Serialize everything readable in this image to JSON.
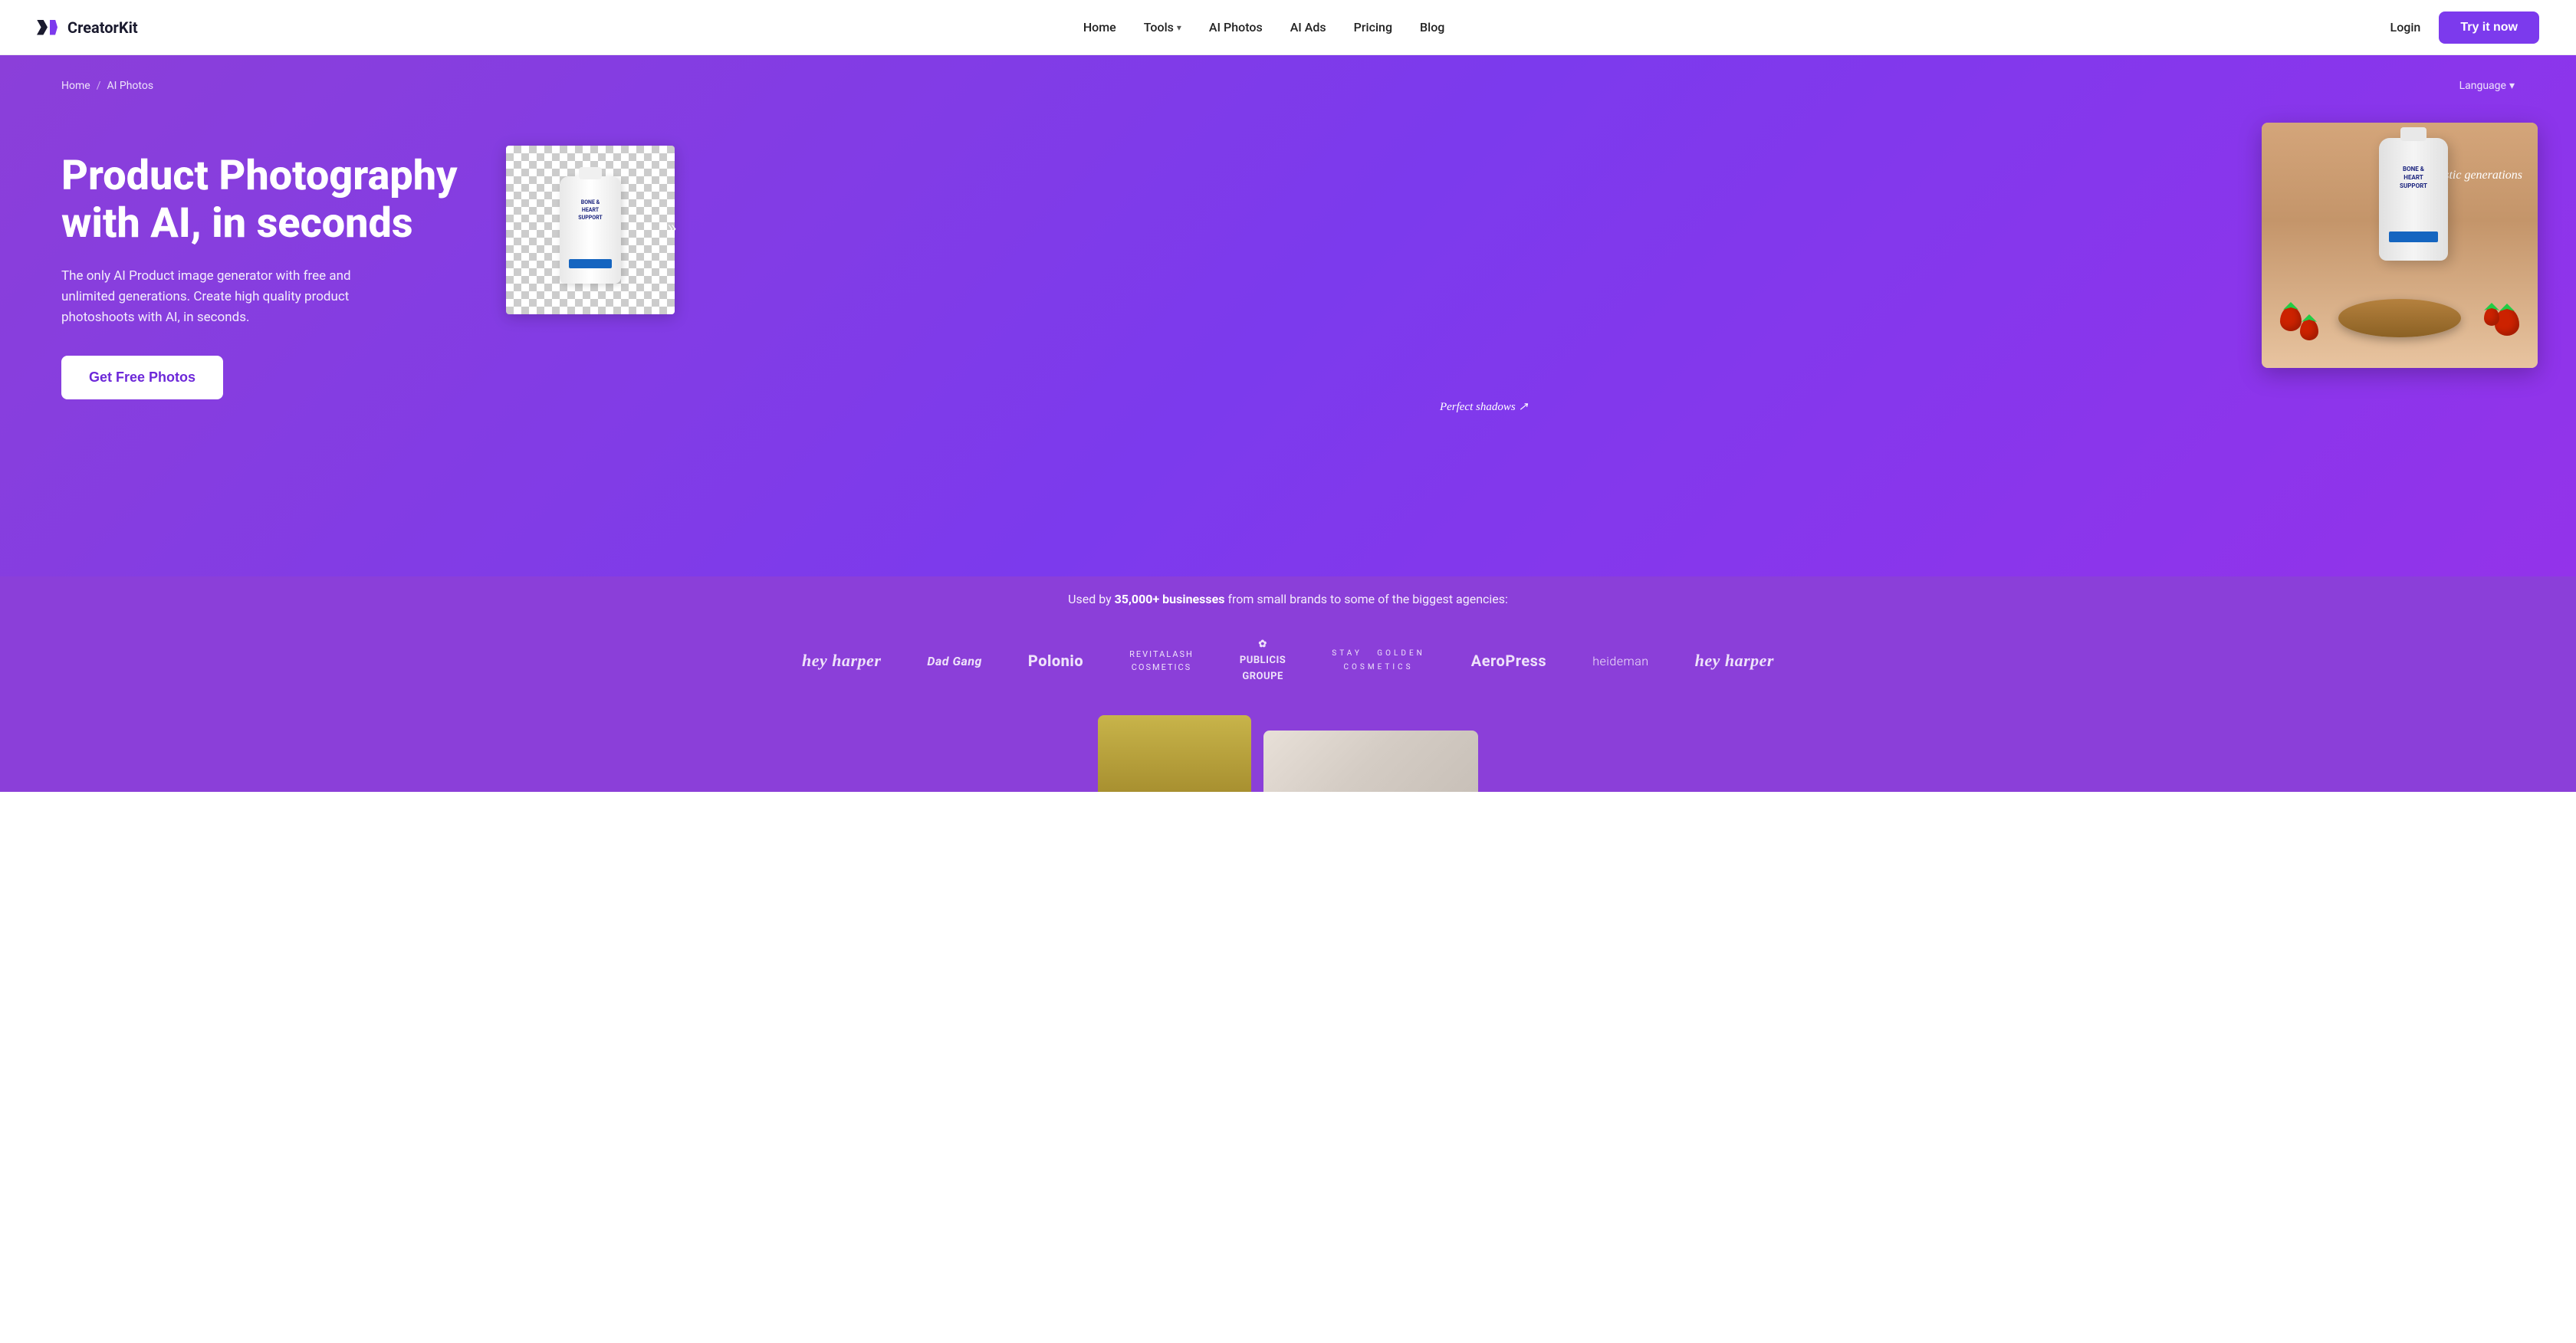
{
  "navbar": {
    "logo_text": "CreatorKit",
    "nav_items": [
      {
        "label": "Home",
        "href": "#"
      },
      {
        "label": "Tools",
        "href": "#",
        "has_dropdown": true
      },
      {
        "label": "AI Photos",
        "href": "#"
      },
      {
        "label": "AI Ads",
        "href": "#"
      },
      {
        "label": "Pricing",
        "href": "#"
      },
      {
        "label": "Blog",
        "href": "#"
      }
    ],
    "login_label": "Login",
    "try_label": "Try it now"
  },
  "breadcrumb": {
    "home": "Home",
    "separator": "/",
    "current": "AI Photos",
    "language": "Language"
  },
  "hero": {
    "title": "Product Photography with AI, in seconds",
    "subtitle": "The only AI Product image generator with free and unlimited generations. Create high quality product photoshoots with AI, in seconds.",
    "cta_label": "Get Free Photos",
    "photorealistic_label": "Photorealistic generations",
    "shadows_label": "Perfect shadows"
  },
  "social_proof": {
    "text_before": "Used by ",
    "highlight": "35,000+ businesses",
    "text_after": " from small brands to some of the biggest agencies:",
    "brands": [
      {
        "name": "hey harper",
        "class": "hey-harper"
      },
      {
        "name": "Dad Gang",
        "class": "dad-gang"
      },
      {
        "name": "Polonio",
        "class": "polonio"
      },
      {
        "name": "REVITALASH\nCOSMETICS",
        "class": "revitalash"
      },
      {
        "name": "✿\nPUBLICIS\nGROUPE",
        "class": "publicis"
      },
      {
        "name": "STAY  GOLDEN\nCOSMETICS",
        "class": "stay-golden"
      },
      {
        "name": "AeroPress",
        "class": "aeropress"
      },
      {
        "name": "heideman",
        "class": "heideman"
      },
      {
        "name": "hey harper",
        "class": "hey-harper"
      }
    ]
  }
}
